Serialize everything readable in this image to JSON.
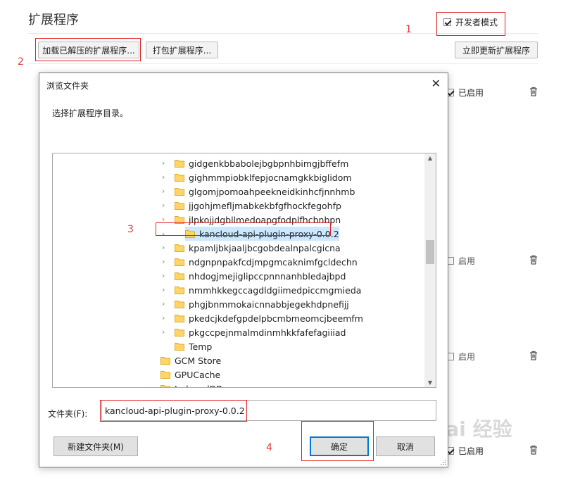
{
  "page": {
    "title": "扩展程序",
    "developer_mode_label": "开发者模式",
    "load_unpacked_label": "加载已解压的扩展程序...",
    "pack_label": "打包扩展程序...",
    "update_now_label": "立即更新扩展程序"
  },
  "extensions": [
    {
      "enabled_label": "已启用",
      "enabled": true
    },
    {
      "enabled_label": "启用",
      "enabled": false
    },
    {
      "enabled_label": "启用",
      "enabled": false
    },
    {
      "enabled_label": "已启用",
      "enabled": true
    }
  ],
  "annotations": [
    "1",
    "2",
    "3",
    "4"
  ],
  "dialog": {
    "title": "浏览文件夹",
    "close_glyph": "✕",
    "description": "选择扩展程序目录。",
    "tree_items": [
      {
        "name": "gidgenkbbabolejbgbpnhbimgjbffefm",
        "expandable": true,
        "selected": false
      },
      {
        "name": "gighmmpiobklfepjocnamgkkbiglidom",
        "expandable": true,
        "selected": false
      },
      {
        "name": "glgomjpomoahpeekneidkinhcfjnnhmb",
        "expandable": true,
        "selected": false
      },
      {
        "name": "jjgohjmefljmabkekbfgfhockfegohfp",
        "expandable": true,
        "selected": false
      },
      {
        "name": "jlpkojjdgbllmedoapgfodplfhcbnbpn",
        "expandable": true,
        "selected": false
      },
      {
        "name": "kancloud-api-plugin-proxy-0.0.2",
        "expandable": true,
        "selected": true
      },
      {
        "name": "kpamljbkjaaljbcgobdealnpalcgicna",
        "expandable": true,
        "selected": false
      },
      {
        "name": "ndgnpnpakfcdjmpgmcaknimfgcldechn",
        "expandable": true,
        "selected": false
      },
      {
        "name": "nhdogjmejiglipccpnnnanhbledajbpd",
        "expandable": true,
        "selected": false
      },
      {
        "name": "nmmhkkegccagdldgiimedpiccmgmieda",
        "expandable": true,
        "selected": false
      },
      {
        "name": "phgjbnmmokaicnnabbjegekhdpnefijj",
        "expandable": true,
        "selected": false
      },
      {
        "name": "pkedcjkdefgpdelpbcmbmeomcjbeemfm",
        "expandable": true,
        "selected": false
      },
      {
        "name": "pkgccpejnmalmdinmhkkfafefagiiiad",
        "expandable": true,
        "selected": false
      },
      {
        "name": "Temp",
        "expandable": false,
        "selected": false
      },
      {
        "name": "GCM Store",
        "expandable": false,
        "selected": false
      },
      {
        "name": "GPUCache",
        "expandable": false,
        "selected": false
      },
      {
        "name": "IndexedDB",
        "expandable": true,
        "selected": false
      }
    ],
    "folder_label": "文件夹(F):",
    "folder_value": "kancloud-api-plugin-proxy-0.0.2",
    "new_folder_label": "新建文件夹(M)",
    "ok_label": "确定",
    "cancel_label": "取消"
  },
  "watermark": "Bai 经验"
}
